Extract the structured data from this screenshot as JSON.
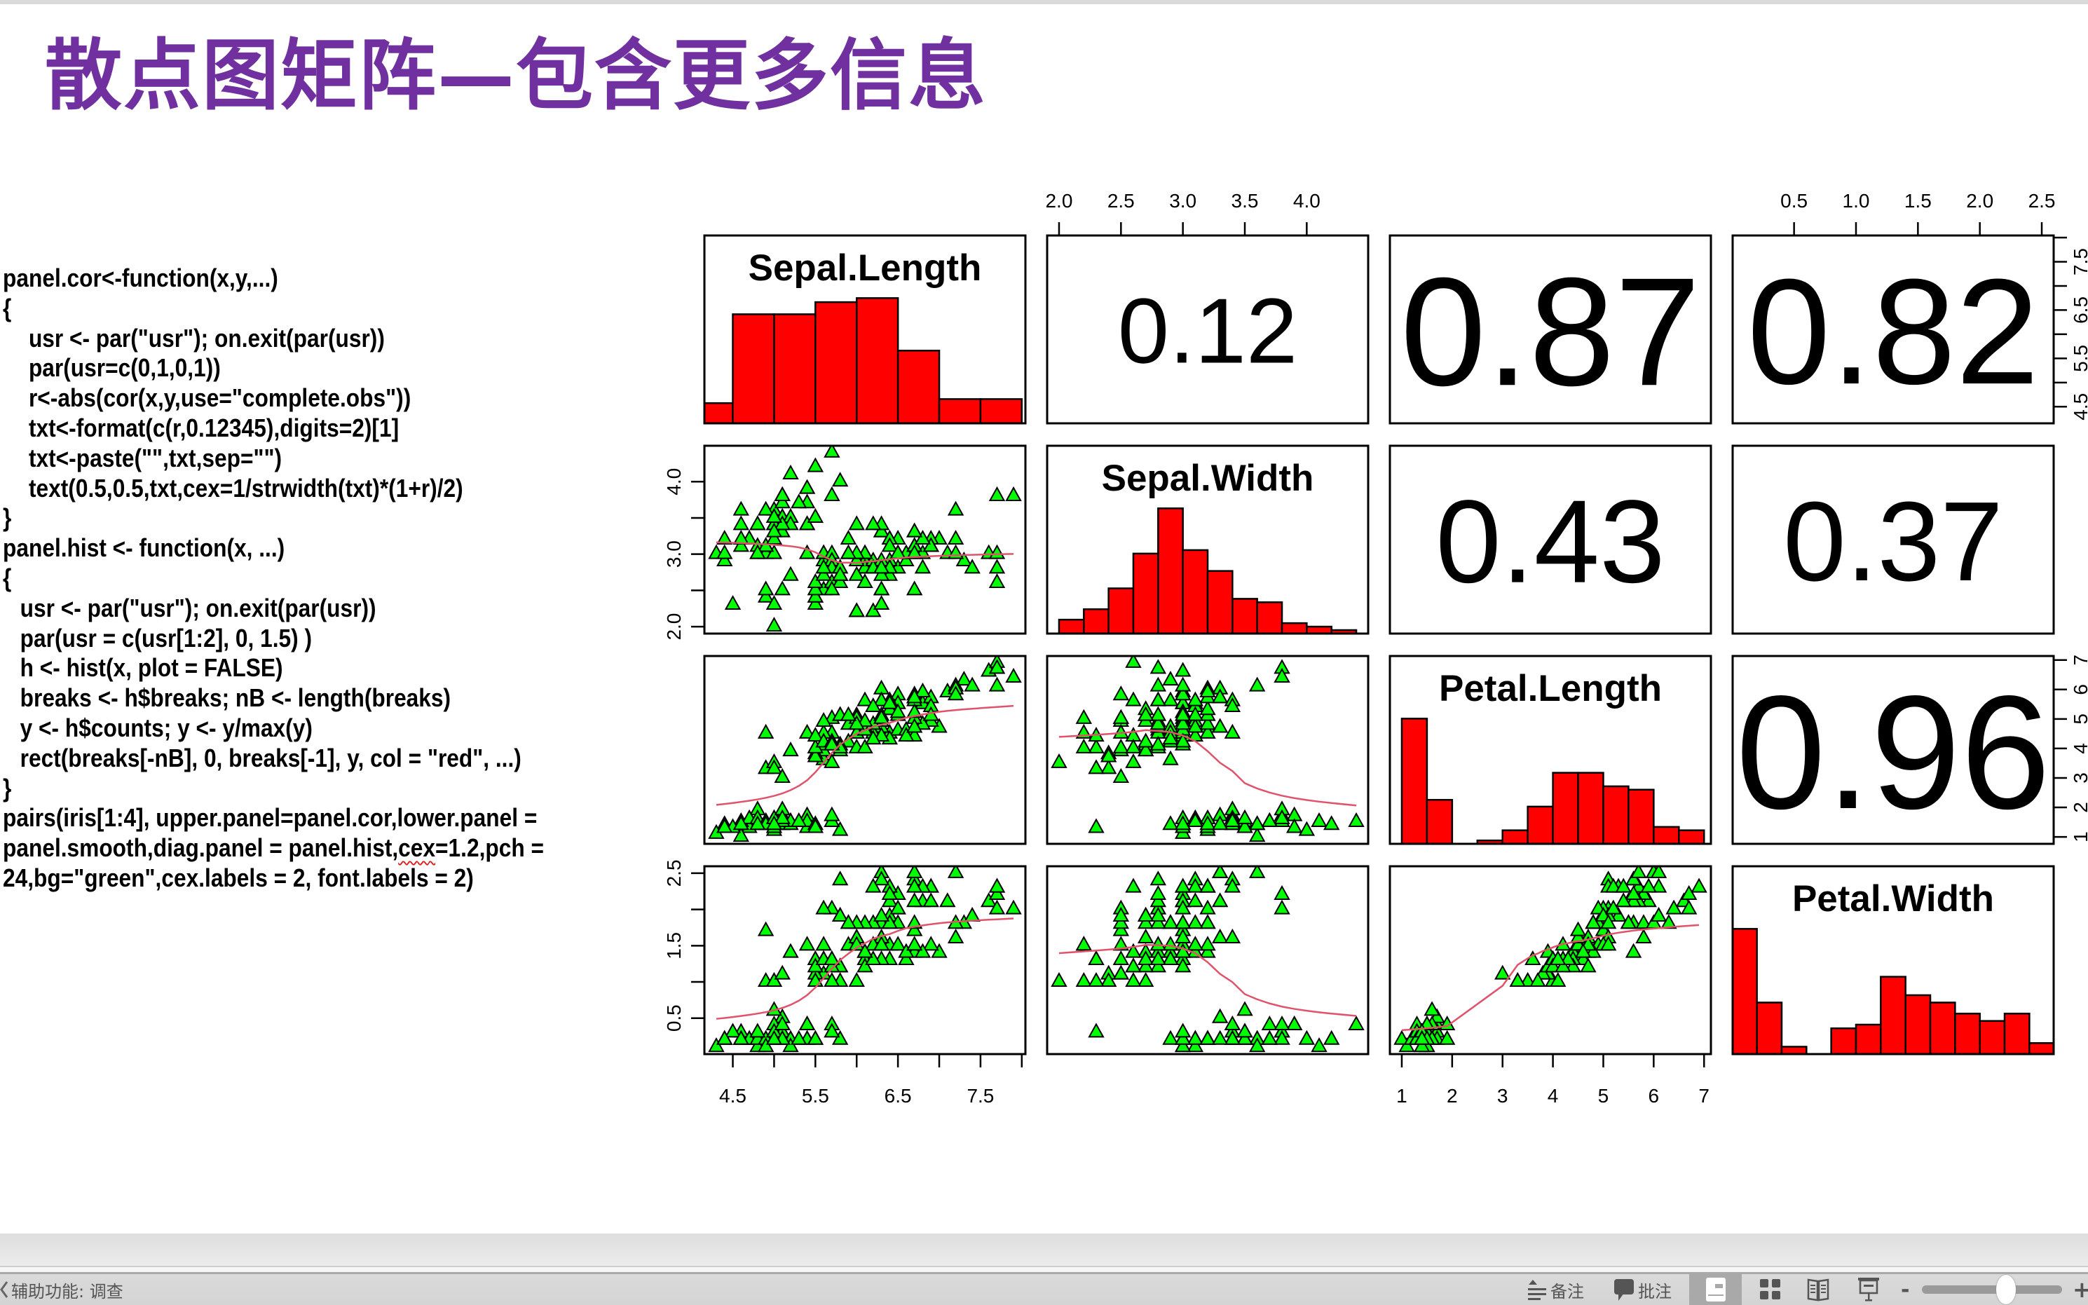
{
  "slide": {
    "title": "散点图矩阵—包含更多信息",
    "title_color": "#7030A0"
  },
  "code": {
    "lines": [
      "panel.cor<-function(x,y,...)",
      "{",
      "   usr <- par(\"usr\"); on.exit(par(usr))",
      "   par(usr=c(0,1,0,1))",
      "   r<-abs(cor(x,y,use=\"complete.obs\"))",
      "   txt<-format(c(r,0.12345),digits=2)[1]",
      "   txt<-paste(\"\",txt,sep=\"\")",
      "   text(0.5,0.5,txt,cex=1/strwidth(txt)*(1+r)/2)",
      "}",
      "panel.hist <- function(x, ...)",
      "{",
      "  usr <- par(\"usr\"); on.exit(par(usr))",
      "  par(usr = c(usr[1:2], 0, 1.5) )",
      "  h <- hist(x, plot = FALSE)",
      "  breaks <- h$breaks; nB <- length(breaks)",
      "  y <- h$counts; y <- y/max(y)",
      "  rect(breaks[-nB], 0, breaks[-1], y, col = \"red\", ...)",
      "}",
      "pairs(iris[1:4], upper.panel=panel.cor,lower.panel =",
      [
        {
          "text": "panel.smooth,diag.panel = panel.hist,"
        },
        {
          "text": "cex",
          "misspelled": true
        },
        {
          "text": "=1.2,pch ="
        }
      ],
      "24,bg=\"green\",cex.labels = 2, font.labels = 2)"
    ]
  },
  "chart_data": {
    "type": "scatter-matrix",
    "title": "",
    "variables": [
      "Sepal.Length",
      "Sepal.Width",
      "Petal.Length",
      "Petal.Width"
    ],
    "data": {
      "Sepal.Length": [
        5.1,
        4.9,
        4.7,
        4.6,
        5.0,
        5.4,
        4.6,
        5.0,
        4.4,
        4.9,
        5.4,
        4.8,
        4.8,
        4.3,
        5.8,
        5.7,
        5.4,
        5.1,
        5.7,
        5.1,
        5.4,
        5.1,
        4.6,
        5.1,
        4.8,
        5.0,
        5.0,
        5.2,
        5.2,
        4.7,
        4.8,
        5.4,
        5.2,
        5.5,
        4.9,
        5.0,
        5.5,
        4.9,
        4.4,
        5.1,
        5.0,
        4.5,
        4.4,
        5.0,
        5.1,
        4.8,
        5.1,
        4.6,
        5.3,
        5.0,
        7.0,
        6.4,
        6.9,
        5.5,
        6.5,
        5.7,
        6.3,
        4.9,
        6.6,
        5.2,
        5.0,
        5.9,
        6.0,
        6.1,
        5.6,
        6.7,
        5.6,
        5.8,
        6.2,
        5.6,
        5.9,
        6.1,
        6.3,
        6.1,
        6.4,
        6.6,
        6.8,
        6.7,
        6.0,
        5.7,
        5.5,
        5.5,
        5.8,
        6.0,
        5.4,
        6.0,
        6.7,
        6.3,
        5.6,
        5.5,
        5.5,
        6.1,
        5.8,
        5.0,
        5.6,
        5.7,
        5.7,
        6.2,
        5.1,
        5.7,
        6.3,
        5.8,
        7.1,
        6.3,
        6.5,
        7.6,
        4.9,
        7.3,
        6.7,
        7.2,
        6.5,
        6.4,
        6.8,
        5.7,
        5.8,
        6.4,
        6.5,
        7.7,
        7.7,
        6.0,
        6.9,
        5.6,
        7.7,
        6.3,
        6.7,
        7.2,
        6.2,
        6.1,
        6.4,
        7.2,
        7.4,
        7.9,
        6.4,
        6.3,
        6.1,
        7.7,
        6.3,
        6.4,
        6.0,
        6.9,
        6.7,
        6.9,
        5.8,
        6.8,
        6.7,
        6.7,
        6.3,
        6.5,
        6.2,
        5.9
      ],
      "Sepal.Width": [
        3.5,
        3.0,
        3.2,
        3.1,
        3.6,
        3.9,
        3.4,
        3.4,
        2.9,
        3.1,
        3.7,
        3.4,
        3.0,
        3.0,
        4.0,
        4.4,
        3.9,
        3.5,
        3.8,
        3.8,
        3.4,
        3.7,
        3.6,
        3.3,
        3.4,
        3.0,
        3.4,
        3.5,
        3.4,
        3.2,
        3.1,
        3.4,
        4.1,
        4.2,
        3.1,
        3.2,
        3.5,
        3.6,
        3.0,
        3.4,
        3.5,
        2.3,
        3.2,
        3.5,
        3.8,
        3.0,
        3.8,
        3.2,
        3.7,
        3.3,
        3.2,
        3.2,
        3.1,
        2.3,
        2.8,
        2.8,
        3.3,
        2.4,
        2.9,
        2.7,
        2.0,
        3.0,
        2.2,
        2.9,
        2.9,
        3.1,
        3.0,
        2.7,
        2.2,
        2.5,
        3.2,
        2.8,
        2.5,
        2.8,
        2.9,
        3.0,
        2.8,
        3.0,
        2.9,
        2.6,
        2.4,
        2.4,
        2.7,
        2.7,
        3.0,
        3.4,
        3.1,
        2.3,
        3.0,
        2.5,
        2.6,
        3.0,
        2.6,
        2.3,
        2.7,
        3.0,
        2.9,
        2.9,
        2.5,
        2.8,
        3.3,
        2.7,
        3.0,
        2.9,
        3.0,
        3.0,
        2.5,
        2.9,
        2.5,
        3.6,
        3.2,
        2.7,
        3.0,
        2.5,
        2.8,
        3.2,
        3.0,
        3.8,
        2.6,
        2.2,
        3.2,
        2.8,
        2.8,
        2.7,
        3.3,
        3.2,
        2.8,
        3.0,
        2.8,
        3.0,
        2.8,
        3.8,
        2.8,
        2.8,
        2.6,
        3.0,
        3.4,
        3.1,
        3.0,
        3.1,
        3.1,
        3.1,
        2.7,
        3.2,
        3.3,
        3.0,
        2.5,
        3.0,
        3.4,
        3.0
      ],
      "Petal.Length": [
        1.4,
        1.4,
        1.3,
        1.5,
        1.4,
        1.7,
        1.4,
        1.5,
        1.4,
        1.5,
        1.5,
        1.6,
        1.4,
        1.1,
        1.2,
        1.5,
        1.3,
        1.4,
        1.7,
        1.5,
        1.7,
        1.5,
        1.0,
        1.7,
        1.9,
        1.6,
        1.6,
        1.5,
        1.4,
        1.6,
        1.6,
        1.5,
        1.5,
        1.4,
        1.5,
        1.2,
        1.3,
        1.4,
        1.3,
        1.5,
        1.3,
        1.3,
        1.3,
        1.6,
        1.9,
        1.4,
        1.6,
        1.4,
        1.5,
        1.4,
        4.7,
        4.5,
        4.9,
        4.0,
        4.6,
        4.5,
        4.7,
        3.3,
        4.6,
        3.9,
        3.5,
        4.2,
        4.0,
        4.7,
        3.6,
        4.4,
        4.5,
        4.1,
        4.5,
        3.9,
        4.8,
        4.0,
        4.9,
        4.7,
        4.3,
        4.4,
        4.8,
        5.0,
        4.5,
        3.5,
        3.8,
        3.7,
        3.9,
        5.1,
        4.5,
        4.5,
        4.7,
        4.4,
        4.1,
        4.0,
        4.4,
        4.6,
        4.0,
        3.3,
        4.2,
        4.2,
        4.2,
        4.3,
        3.0,
        4.1,
        6.0,
        5.1,
        5.9,
        5.6,
        5.8,
        6.6,
        4.5,
        6.3,
        5.8,
        6.1,
        5.1,
        5.3,
        5.5,
        5.0,
        5.1,
        5.3,
        5.5,
        6.7,
        6.9,
        5.0,
        5.7,
        4.9,
        6.7,
        4.9,
        5.7,
        6.0,
        4.8,
        4.9,
        5.6,
        5.8,
        6.1,
        6.4,
        5.6,
        5.1,
        5.6,
        6.1,
        5.6,
        5.5,
        4.8,
        5.4,
        5.6,
        5.1,
        5.1,
        5.9,
        5.7,
        5.2,
        5.0,
        5.2,
        5.4,
        5.1
      ],
      "Petal.Width": [
        0.2,
        0.2,
        0.2,
        0.2,
        0.2,
        0.4,
        0.3,
        0.2,
        0.2,
        0.1,
        0.2,
        0.2,
        0.1,
        0.1,
        0.2,
        0.4,
        0.4,
        0.3,
        0.3,
        0.3,
        0.2,
        0.4,
        0.2,
        0.5,
        0.2,
        0.2,
        0.4,
        0.2,
        0.2,
        0.2,
        0.2,
        0.4,
        0.1,
        0.2,
        0.2,
        0.2,
        0.2,
        0.1,
        0.2,
        0.2,
        0.3,
        0.3,
        0.2,
        0.6,
        0.4,
        0.3,
        0.2,
        0.2,
        0.2,
        0.2,
        1.4,
        1.5,
        1.5,
        1.3,
        1.5,
        1.3,
        1.6,
        1.0,
        1.3,
        1.4,
        1.0,
        1.5,
        1.0,
        1.4,
        1.3,
        1.4,
        1.5,
        1.0,
        1.5,
        1.1,
        1.8,
        1.3,
        1.5,
        1.2,
        1.3,
        1.4,
        1.4,
        1.7,
        1.5,
        1.0,
        1.1,
        1.0,
        1.2,
        1.6,
        1.5,
        1.6,
        1.5,
        1.3,
        1.3,
        1.3,
        1.2,
        1.4,
        1.2,
        1.0,
        1.3,
        1.2,
        1.3,
        1.3,
        1.1,
        1.3,
        2.5,
        1.9,
        2.1,
        1.8,
        2.2,
        2.1,
        1.7,
        1.8,
        1.8,
        2.5,
        2.0,
        1.9,
        2.1,
        2.0,
        2.4,
        2.3,
        1.8,
        2.2,
        2.3,
        1.5,
        2.3,
        2.0,
        2.0,
        1.8,
        2.1,
        1.8,
        1.8,
        1.8,
        2.1,
        1.6,
        1.9,
        2.0,
        2.2,
        1.5,
        1.4,
        2.3,
        2.4,
        1.8,
        1.8,
        2.1,
        2.4,
        2.3,
        1.9,
        2.3,
        2.5,
        2.3,
        1.9,
        2.0,
        2.3,
        1.8
      ]
    },
    "upper_panel": {
      "type": "correlation",
      "cells": [
        {
          "row": 1,
          "col": 2,
          "value": "0.12"
        },
        {
          "row": 1,
          "col": 3,
          "value": "0.87"
        },
        {
          "row": 1,
          "col": 4,
          "value": "0.82"
        },
        {
          "row": 2,
          "col": 3,
          "value": "0.43"
        },
        {
          "row": 2,
          "col": 4,
          "value": "0.37"
        },
        {
          "row": 3,
          "col": 4,
          "value": "0.96"
        }
      ]
    },
    "diag_panel": {
      "type": "histogram",
      "fill": "#FF0000",
      "breaks": {
        "Sepal.Length": [
          4.0,
          4.5,
          5.0,
          5.5,
          6.0,
          6.5,
          7.0,
          7.5,
          8.0
        ],
        "Sepal.Width": [
          2.0,
          2.2,
          2.4,
          2.6,
          2.8,
          3.0,
          3.2,
          3.4,
          3.6,
          3.8,
          4.0,
          4.2,
          4.4
        ],
        "Petal.Length": [
          1.0,
          1.5,
          2.0,
          2.5,
          3.0,
          3.5,
          4.0,
          4.5,
          5.0,
          5.5,
          6.0,
          6.5,
          7.0
        ],
        "Petal.Width": [
          0.0,
          0.2,
          0.4,
          0.6,
          0.8,
          1.0,
          1.2,
          1.4,
          1.6,
          1.8,
          2.0,
          2.2,
          2.4,
          2.6
        ]
      }
    },
    "lower_panel": {
      "type": "scatter with lowess smooth",
      "point_shape": "triangle",
      "point_fill": "#00FF00",
      "point_stroke": "#000000",
      "smooth_color": "#DF536B"
    },
    "axes": {
      "Sepal.Length": {
        "ticks": [
          4.5,
          5.0,
          5.5,
          6.0,
          6.5,
          7.0,
          7.5,
          8.0
        ],
        "labels": [
          {
            "at": 4.5,
            "text": "4.5"
          },
          {
            "at": 5.5,
            "text": "5.5"
          },
          {
            "at": 6.5,
            "text": "6.5"
          },
          {
            "at": 7.5,
            "text": "7.5"
          }
        ]
      },
      "Sepal.Width": {
        "ticks": [
          2.0,
          2.5,
          3.0,
          3.5,
          4.0
        ],
        "labels_top": [
          {
            "at": 2.0,
            "text": "2.0"
          },
          {
            "at": 2.5,
            "text": "2.5"
          },
          {
            "at": 3.0,
            "text": "3.0"
          },
          {
            "at": 3.5,
            "text": "3.5"
          },
          {
            "at": 4.0,
            "text": "4.0"
          }
        ],
        "labels_left": [
          {
            "at": 2.0,
            "text": "2.0"
          },
          {
            "at": 3.0,
            "text": "3.0"
          },
          {
            "at": 4.0,
            "text": "4.0"
          }
        ]
      },
      "Petal.Length": {
        "ticks": [
          1,
          2,
          3,
          4,
          5,
          6,
          7
        ],
        "labels": [
          {
            "at": 1,
            "text": "1"
          },
          {
            "at": 2,
            "text": "2"
          },
          {
            "at": 3,
            "text": "3"
          },
          {
            "at": 4,
            "text": "4"
          },
          {
            "at": 5,
            "text": "5"
          },
          {
            "at": 6,
            "text": "6"
          },
          {
            "at": 7,
            "text": "7"
          }
        ]
      },
      "Petal.Width": {
        "ticks": [
          0.5,
          1.0,
          1.5,
          2.0,
          2.5
        ],
        "labels_top": [
          {
            "at": 0.5,
            "text": "0.5"
          },
          {
            "at": 1.0,
            "text": "1.0"
          },
          {
            "at": 1.5,
            "text": "1.5"
          },
          {
            "at": 2.0,
            "text": "2.0"
          },
          {
            "at": 2.5,
            "text": "2.5"
          }
        ],
        "labels_left": [
          {
            "at": 0.5,
            "text": "0.5"
          },
          {
            "at": 1.5,
            "text": "1.5"
          },
          {
            "at": 2.5,
            "text": "2.5"
          }
        ]
      }
    }
  },
  "status_bar": {
    "accessibility": "辅助功能: 调查",
    "notes": "备注",
    "comments": "批注",
    "views": [
      "normal-view",
      "slide-sorter",
      "reading-view",
      "slideshow"
    ],
    "active_view": "normal-view",
    "zoom_minus": "-",
    "zoom_plus": "+",
    "zoom_level": 0.6
  }
}
